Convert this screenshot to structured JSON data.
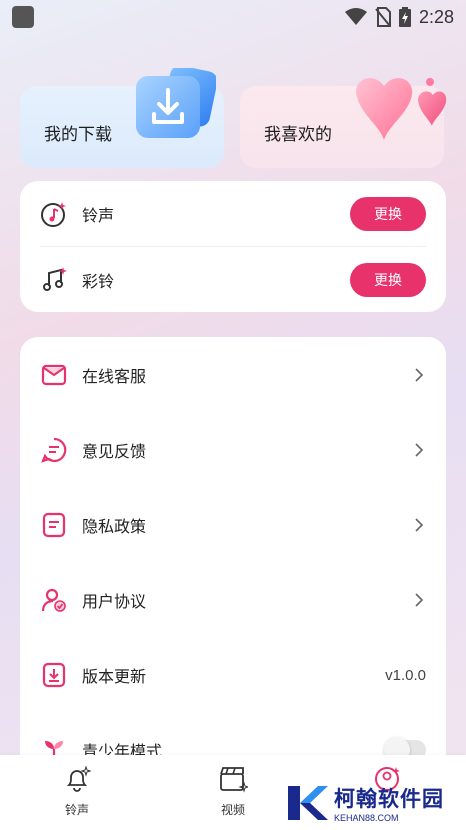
{
  "status_bar": {
    "time": "2:28",
    "icons": [
      "wifi-icon",
      "no-sim-icon",
      "battery-charging-icon"
    ]
  },
  "top_cards": {
    "download_label": "我的下载",
    "favorite_label": "我喜欢的"
  },
  "ring_card": {
    "items": [
      {
        "label": "铃声",
        "icon": "ringtone-note-icon",
        "button": "更换"
      },
      {
        "label": "彩铃",
        "icon": "color-ring-music-icon",
        "button": "更换"
      }
    ]
  },
  "menu": {
    "items": [
      {
        "label": "在线客服",
        "icon": "customer-service-icon"
      },
      {
        "label": "意见反馈",
        "icon": "feedback-icon"
      },
      {
        "label": "隐私政策",
        "icon": "privacy-policy-icon"
      },
      {
        "label": "用户协议",
        "icon": "user-agreement-icon"
      },
      {
        "label": "版本更新",
        "icon": "version-update-icon",
        "value": "v1.0.0"
      },
      {
        "label": "青少年模式",
        "icon": "youth-mode-icon",
        "toggle": false
      }
    ]
  },
  "bottom_nav": {
    "items": [
      {
        "label": "铃声",
        "icon": "bell-icon"
      },
      {
        "label": "视频",
        "icon": "video-clapper-icon"
      },
      {
        "label": "",
        "icon": "mine-icon"
      }
    ]
  },
  "watermark": {
    "title": "柯翰软件园",
    "subtitle": "KEHAN88.COM"
  },
  "colors": {
    "accent": "#e8326c",
    "download_card": "#dbeafc",
    "favorite_card": "#f8e4ec"
  }
}
